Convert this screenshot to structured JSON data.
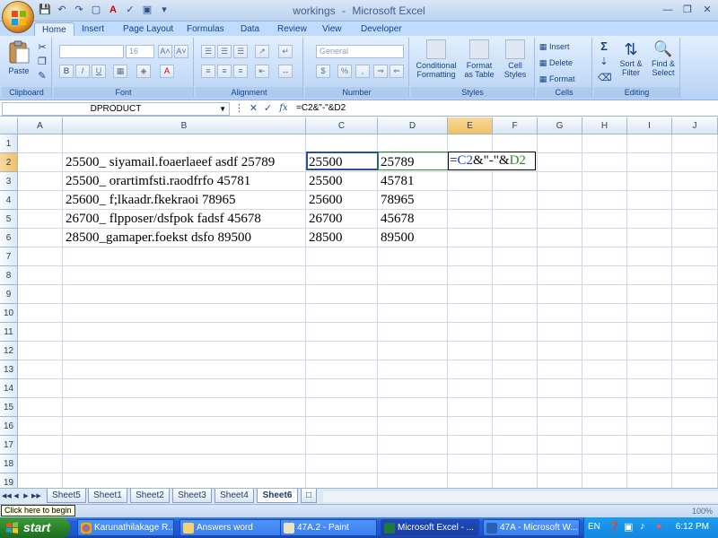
{
  "window": {
    "title": "workings",
    "title_sep": "-",
    "app_name": "Microsoft Excel"
  },
  "tabs": [
    "Home",
    "Insert",
    "Page Layout",
    "Formulas",
    "Data",
    "Review",
    "View",
    "Developer"
  ],
  "active_tab": "Home",
  "ribbon": {
    "clipboard": {
      "label": "Clipboard",
      "paste": "Paste"
    },
    "font": {
      "label": "Font",
      "font_size": "16",
      "bold": "B",
      "italic": "I",
      "underline": "U",
      "grow": "A˄",
      "shrink": "A˅",
      "color": "A"
    },
    "alignment": {
      "label": "Alignment"
    },
    "number": {
      "label": "Number",
      "format": "General",
      "currency": "$",
      "percent": "%",
      "comma": ","
    },
    "styles": {
      "label": "Styles",
      "conditional": "Conditional Formatting",
      "format_table": "Format as Table",
      "cell_styles": "Cell Styles"
    },
    "cells": {
      "label": "Cells",
      "insert": "Insert",
      "delete": "Delete",
      "format": "Format"
    },
    "editing": {
      "label": "Editing",
      "sort": "Sort & Filter",
      "find": "Find & Select",
      "sigma": "Σ"
    }
  },
  "formula_bar": {
    "name_box": "DPRODUCT",
    "fx": "fx",
    "formula": "=C2&\"-\"&D2"
  },
  "columns": [
    "A",
    "B",
    "C",
    "D",
    "E",
    "F",
    "G",
    "H",
    "I",
    "J"
  ],
  "active_column": "E",
  "rows": [
    "1",
    "2",
    "3",
    "4",
    "5",
    "6",
    "7",
    "8",
    "9",
    "10",
    "11",
    "12",
    "13",
    "14",
    "15",
    "16",
    "17",
    "18",
    "19"
  ],
  "active_row": "2",
  "cells": [
    {
      "row": 2,
      "b": "25500_ siyamail.foaerlaeef asdf 25789",
      "c": "25500",
      "d": "25789"
    },
    {
      "row": 3,
      "b": "25500_ orartimfsti.raodfrfo 45781",
      "c": "25500",
      "d": "45781"
    },
    {
      "row": 4,
      "b": "25600_ f;lkaadr.fkekraoi 78965",
      "c": "25600",
      "d": "78965"
    },
    {
      "row": 5,
      "b": "26700_ flpposer/dsfpok  fadsf 45678",
      "c": "26700",
      "d": "45678"
    },
    {
      "row": 6,
      "b": "28500_gamaper.foekst dsfo 89500",
      "c": "28500",
      "d": "89500"
    }
  ],
  "edit_cell": {
    "eq": "=",
    "ref1": "C2",
    "mid": "&\"-\"&",
    "ref2": "D2"
  },
  "sheets": [
    "Sheet5",
    "Sheet1",
    "Sheet2",
    "Sheet3",
    "Sheet4",
    "Sheet6"
  ],
  "active_sheet": "Sheet6",
  "status": {
    "tooltip": "Click here to begin",
    "zoom": "100%"
  },
  "taskbar": {
    "start": "start",
    "tasks": [
      "Karunathilakage R...",
      "Answers word",
      "47A.2 - Paint",
      "Microsoft Excel - ...",
      "47A - Microsoft W..."
    ],
    "active_task": "Microsoft Excel - ...",
    "lang": "EN",
    "clock": "6:12 PM"
  },
  "colors": {
    "ribbon_bg": "#c4dbf7",
    "selection_border": "#2b4f9e",
    "ref_c": "#1f3fb8",
    "ref_d": "#2a8a2a",
    "taskbar": "#245edb",
    "start": "#2e8b2e"
  }
}
